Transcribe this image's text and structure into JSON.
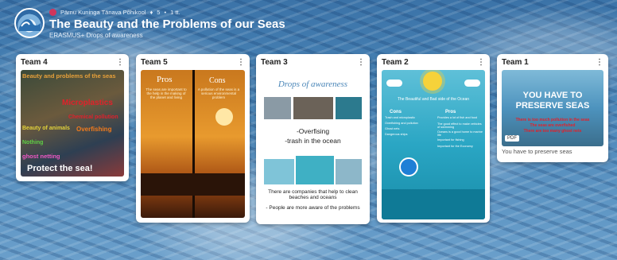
{
  "header": {
    "school": "Pärnu Kuninga Tänava Põhikool",
    "likes": "5",
    "age": "1 tt.",
    "title": "The Beauty and the Problems of our Seas",
    "subtitle": "ERASMUS+ Drops of awareness"
  },
  "cards": {
    "team4": {
      "label": "Team 4",
      "lines": [
        "Beauty and problems of the seas",
        "Microplastics",
        "Chemical pollution",
        "Overfishing",
        "Beauty of animals",
        "Nothing",
        "ghost netting",
        "Protect the sea!"
      ]
    },
    "team5": {
      "label": "Team 5",
      "pros": "Pros",
      "cons": "Cons",
      "pros_text": "The seas are important to the help in the making of the planet and living",
      "cons_text": "A pollution of the seas is a serious environmental problem"
    },
    "team3": {
      "label": "Team 3",
      "banner": "Drops of awareness",
      "line1": "-Overfising",
      "line2": "-trash in the ocean",
      "bottom1": "There are companies that help to clean beaches and oceans",
      "bottom2": "- People are more aware of the problems"
    },
    "team2": {
      "label": "Team 2",
      "heading": "The Beautiful and Bad side of the Ocean",
      "cons": "Cons",
      "pros": "Pros",
      "cons_items": [
        "Trash and microplastic",
        "Overfishing and pollution",
        "Ghost nets",
        "Dangerous ships"
      ],
      "pros_items": [
        "Provides a lot of fish and food",
        "The good effect to make vehicles of swimming",
        "Oceans is a good home to marine life",
        "Important for fishing",
        "Important for the Economy"
      ]
    },
    "team1": {
      "label": "Team 1",
      "headline": "YOU HAVE TO PRESERVE SEAS",
      "red1": "There is too much pollution in the seas",
      "red2": "The seas are overfished",
      "red3": "There are too many ghost nets",
      "pdf": "PDF",
      "caption": "You have to preserve seas"
    }
  },
  "colors": {
    "accent_red": "#e0212b",
    "header_text": "#ffffff"
  }
}
